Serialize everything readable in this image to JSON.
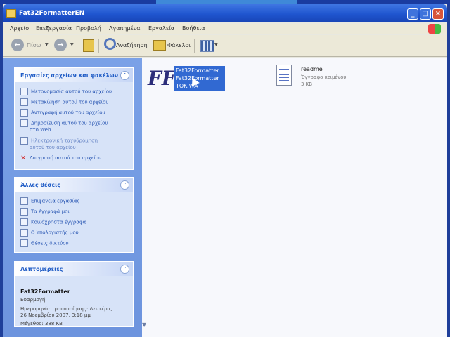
{
  "window": {
    "title": "Fat32FormatterEN"
  },
  "titlebar": {
    "minimize": "_",
    "maximize": "□",
    "close": "×"
  },
  "menu": [
    "Αρχείο",
    "Επεξεργασία",
    "Προβολή",
    "Αγαπημένα",
    "Εργαλεία",
    "Βοήθεια"
  ],
  "toolbar": {
    "back_label": "Πίσω",
    "back_arrow": "←",
    "forward_arrow": "→",
    "dropdown_glyph": "▼",
    "search_label": "Αναζήτηση",
    "folders_label": "Φάκελοι"
  },
  "sidebar": {
    "collapse_glyph": "⌃",
    "file_tasks": {
      "title": "Εργασίες αρχείων και φακέλων",
      "items": [
        "Μετονομασία αυτού του αρχείου",
        "Μετακίνηση αυτού του αρχείου",
        "Αντιγραφή αυτού του αρχείου",
        "Δημοσίευση αυτού του αρχείου",
        "στο Web",
        "Ηλεκτρονική ταχυδρόμηση",
        "αυτού του αρχείου",
        "Διαγραφή αυτού του αρχείου"
      ]
    },
    "other_places": {
      "title": "Άλλες θέσεις",
      "items": [
        "Επιφάνεια εργασίας",
        "Τα έγγραφά μου",
        "Κοινόχρηστα έγγραφα",
        "Ο Υπολογιστής μου",
        "Θέσεις δικτύου"
      ]
    },
    "details": {
      "title": "Λεπτομέρειες",
      "name": "Fat32Formatter",
      "type": "Εφαρμογή",
      "modified_line1": "Ημερομηνία τροποποίησης: Δευτέρα,",
      "modified_line2": "26 Νοεμβρίου 2007, 3:18 μμ",
      "size": "Μέγεθος: 388 KB"
    }
  },
  "files": [
    {
      "name_line1": "Fat32Formatter",
      "name_line2": "Fat32Formatter",
      "name_line3": "TOKIWA",
      "logo_text": "FF",
      "selected": true
    },
    {
      "name": "readme",
      "type": "Έγγραφο κειμένου",
      "size": "3 KB",
      "selected": false
    }
  ],
  "content": {
    "scroll_down": "▼"
  },
  "colors": {
    "selection": "#3169d2",
    "task_link": "#2a57b3",
    "titlebar": "#1f55cf"
  }
}
